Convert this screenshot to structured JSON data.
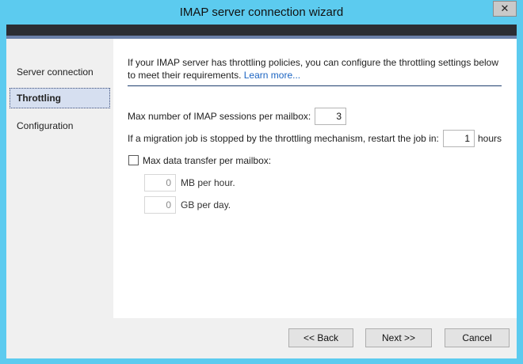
{
  "window": {
    "title": "IMAP server connection wizard",
    "close_glyph": "✕",
    "accent_color": "#5ccbef"
  },
  "nav": {
    "items": [
      {
        "label": "Server connection",
        "selected": false
      },
      {
        "label": "Throttling",
        "selected": true
      },
      {
        "label": "Configuration",
        "selected": false
      }
    ]
  },
  "content": {
    "intro": "If your IMAP server has throttling policies, you can configure the throttling settings below to meet their requirements.",
    "learn_more": "Learn more...",
    "sessions_label": "Max number of IMAP sessions per mailbox:",
    "sessions_value": "3",
    "restart_label": "If a migration job is stopped by the throttling mechanism, restart the job in:",
    "restart_value": "1",
    "restart_unit": "hours",
    "max_transfer_label": "Max data transfer per mailbox:",
    "max_transfer_checked": false,
    "mb_value": "0",
    "mb_unit": "MB per hour.",
    "gb_value": "0",
    "gb_unit": "GB per day."
  },
  "footer": {
    "back_label": "<< Back",
    "next_label": "Next >>",
    "cancel_label": "Cancel"
  }
}
